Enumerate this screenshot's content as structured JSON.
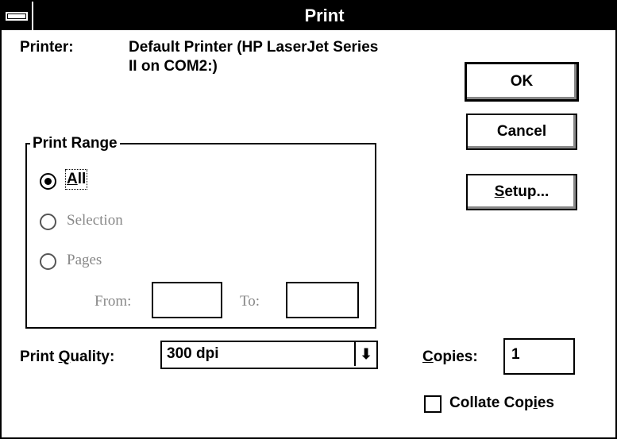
{
  "window": {
    "title": "Print"
  },
  "printer": {
    "label": "Printer:",
    "line1": "Default Printer (HP LaserJet Series",
    "line2": "II on COM2:)"
  },
  "buttons": {
    "ok": "OK",
    "cancel": "Cancel",
    "setup": "Setup..."
  },
  "print_range": {
    "label": "Print Range",
    "all": "All",
    "selection": "Selection",
    "pages": "Pages",
    "from_label": "From:",
    "to_label": "To:",
    "from_value": "",
    "to_value": ""
  },
  "print_quality": {
    "label": "Print Quality:",
    "value": "300 dpi"
  },
  "copies": {
    "label": "Copies:",
    "value": "1"
  },
  "collate": {
    "label": "Collate Copies",
    "checked": false
  }
}
